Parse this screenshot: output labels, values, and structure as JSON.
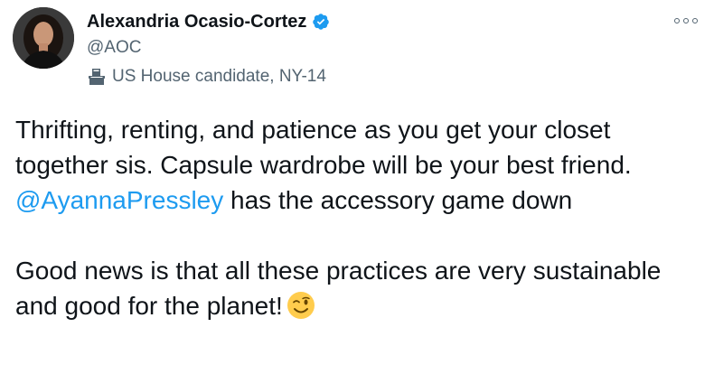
{
  "author": {
    "display_name": "Alexandria Ocasio-Cortez",
    "handle": "@AOC",
    "verified": true,
    "label_icon": "ballot-box-icon",
    "label": "US House candidate, NY-14"
  },
  "menu": {
    "icon": "more-options-icon"
  },
  "tweet": {
    "line1_before": "Thrifting, renting, and patience as you get your closet together sis. Capsule wardrobe will be your best friend. ",
    "mention": "@AyannaPressley",
    "line1_after": " has the accessory game down",
    "line2": "Good news is that all these practices are very sustainable and good for the planet!",
    "emoji": "winking-face-emoji"
  },
  "colors": {
    "text": "#0f1419",
    "secondary": "#536471",
    "link": "#1d9bf0",
    "verified": "#1d9bf0"
  }
}
